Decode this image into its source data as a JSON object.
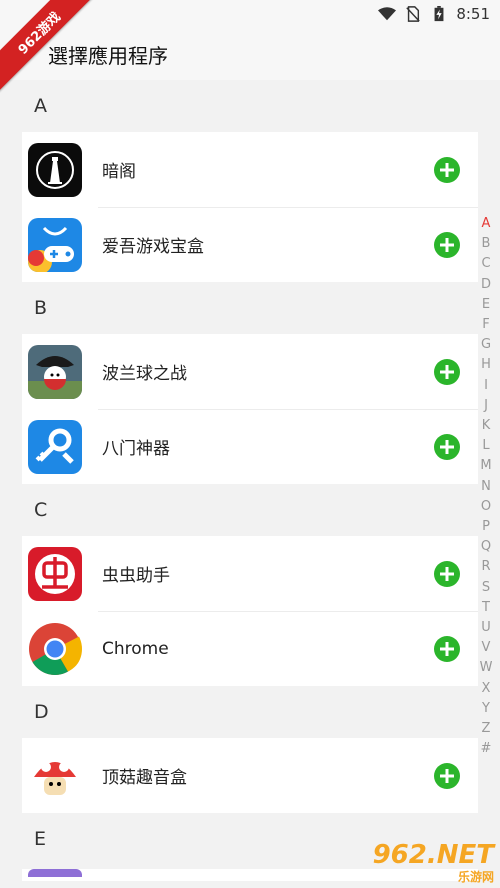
{
  "status_bar": {
    "time": "8:51"
  },
  "watermark_ribbon": "962游戏",
  "header": {
    "title": "選擇應用程序"
  },
  "sections": [
    {
      "letter": "A",
      "apps": [
        {
          "name": "暗阁",
          "icon": "lighthouse-icon"
        },
        {
          "name": "爱吾游戏宝盒",
          "icon": "gamepad-icon"
        }
      ]
    },
    {
      "letter": "B",
      "apps": [
        {
          "name": "波兰球之战",
          "icon": "polandball-icon"
        },
        {
          "name": "八门神器",
          "icon": "key-wrench-icon"
        }
      ]
    },
    {
      "letter": "C",
      "apps": [
        {
          "name": "虫虫助手",
          "icon": "chongchong-icon"
        },
        {
          "name": "Chrome",
          "icon": "chrome-icon"
        }
      ]
    },
    {
      "letter": "D",
      "apps": [
        {
          "name": "顶菇趣音盒",
          "icon": "mushroom-icon"
        }
      ]
    },
    {
      "letter": "E",
      "apps": []
    }
  ],
  "index_letters": [
    "A",
    "B",
    "C",
    "D",
    "E",
    "F",
    "G",
    "H",
    "I",
    "J",
    "K",
    "L",
    "M",
    "N",
    "O",
    "P",
    "Q",
    "R",
    "S",
    "T",
    "U",
    "V",
    "W",
    "X",
    "Y",
    "Z",
    "#"
  ],
  "colors": {
    "add_green": "#2bb52b",
    "index_active": "#e53935"
  },
  "footer_watermark": {
    "brand": "962.NET",
    "sub": "乐游网"
  }
}
